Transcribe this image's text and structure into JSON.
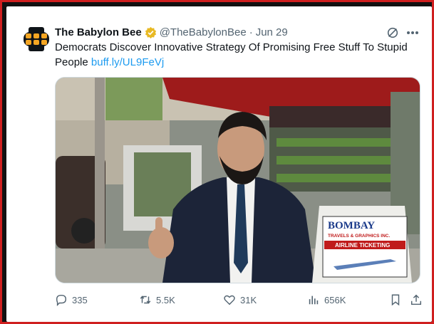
{
  "tweet": {
    "author_name": "The Babylon Bee",
    "handle": "@TheBabylonBee",
    "separator": "·",
    "date": "Jun 29",
    "text": "Democrats Discover Innovative Strategy Of Promising Free Stuff To Stupid People",
    "link": "buff.ly/UL9FeVj"
  },
  "media": {
    "sign_brand": "BOMBAY",
    "sign_subtitle": "TRAVELS & GRAPHICS INC.",
    "sign_service": "AIRLINE TICKETING"
  },
  "actions": {
    "replies": "335",
    "reposts": "5.5K",
    "likes": "31K",
    "views": "656K"
  },
  "colors": {
    "frame_border": "#cf1f1f",
    "link": "#1d9bf0",
    "verified_badge": "#e8b923",
    "muted_text": "#536471",
    "logo_orange": "#f5a623"
  },
  "icons": [
    "babylon-bee-logo-icon",
    "verified-badge-icon",
    "grok-icon",
    "more-icon",
    "reply-icon",
    "repost-icon",
    "like-icon",
    "views-icon",
    "bookmark-icon",
    "share-icon"
  ]
}
